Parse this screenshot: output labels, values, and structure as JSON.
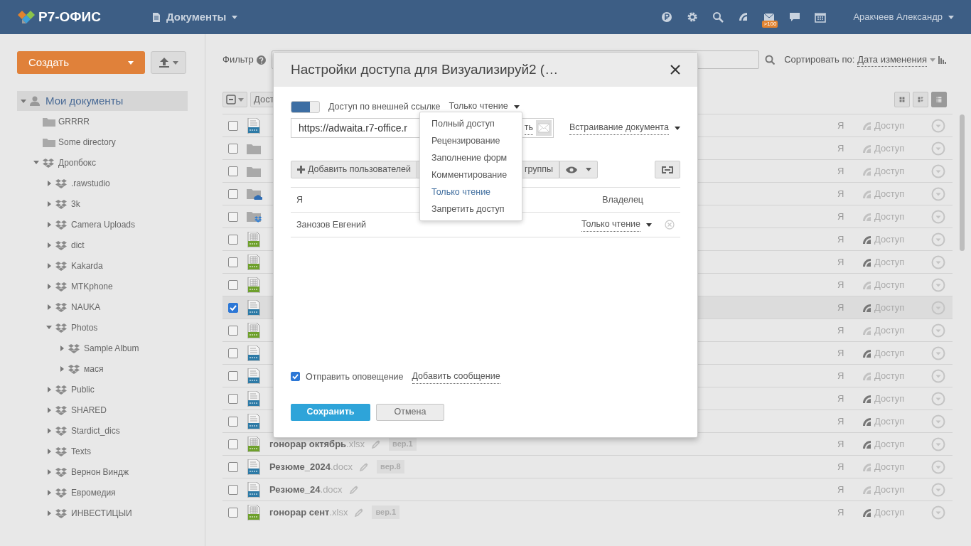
{
  "header": {
    "logo": "Р7-ОФИС",
    "module": "Документы",
    "mail_badge": ">100",
    "user": "Аракчеев Александр"
  },
  "sidebar": {
    "create": "Создать",
    "tree": [
      {
        "label": "Мои документы",
        "kind": "user",
        "expanded": true,
        "selected": true,
        "children": [
          {
            "label": "GRRRR",
            "kind": "folder",
            "selected": false
          },
          {
            "label": "Some directory",
            "kind": "folder",
            "selected": false
          },
          {
            "label": "Дропбокс",
            "kind": "dropbox",
            "expanded": true,
            "selected": false,
            "children": [
              {
                "label": ".rawstudio",
                "kind": "dropbox",
                "expanded": false,
                "selected": false
              },
              {
                "label": "3k",
                "kind": "dropbox",
                "expanded": false,
                "selected": false
              },
              {
                "label": "Camera Uploads",
                "kind": "dropbox",
                "expanded": false,
                "selected": false
              },
              {
                "label": "dict",
                "kind": "dropbox",
                "expanded": false,
                "selected": false
              },
              {
                "label": "Kakarda",
                "kind": "dropbox",
                "expanded": false,
                "selected": false
              },
              {
                "label": "MTKphone",
                "kind": "dropbox",
                "expanded": false,
                "selected": false
              },
              {
                "label": "NAUKA",
                "kind": "dropbox",
                "expanded": false,
                "selected": false
              },
              {
                "label": "Photos",
                "kind": "dropbox",
                "expanded": true,
                "selected": false,
                "children": [
                  {
                    "label": "Sample Album",
                    "kind": "dropbox",
                    "expanded": false,
                    "selected": false
                  },
                  {
                    "label": "мася",
                    "kind": "dropbox",
                    "expanded": false,
                    "selected": false
                  }
                ]
              },
              {
                "label": "Public",
                "kind": "dropbox",
                "expanded": false,
                "selected": false
              },
              {
                "label": "SHARED",
                "kind": "dropbox",
                "expanded": false,
                "selected": false
              },
              {
                "label": "Stardict_dics",
                "kind": "dropbox",
                "expanded": false,
                "selected": false
              },
              {
                "label": "Texts",
                "kind": "dropbox",
                "expanded": false,
                "selected": false
              },
              {
                "label": "Вернон Виндж",
                "kind": "dropbox",
                "expanded": false,
                "selected": false
              },
              {
                "label": "Евромедия",
                "kind": "dropbox",
                "expanded": false,
                "selected": false
              },
              {
                "label": "ИНВЕСТИЦЫИ",
                "kind": "dropbox",
                "expanded": false,
                "selected": false
              }
            ]
          }
        ]
      }
    ]
  },
  "toolbar": {
    "filter_label": "Фильтр",
    "sort_label": "Сортировать по:",
    "sort_value": "Дата изменения",
    "action_button": "Дост",
    "views": [
      {
        "kind": "tiles",
        "selected": false
      },
      {
        "kind": "compact",
        "selected": false
      },
      {
        "kind": "list",
        "selected": true
      }
    ]
  },
  "files": [
    {
      "kind": "document",
      "checked": false,
      "owner": "Я",
      "shared": false,
      "access": "Доступ"
    },
    {
      "kind": "folder",
      "checked": false,
      "owner": "Я",
      "shared": false,
      "access": "Доступ"
    },
    {
      "kind": "folder",
      "checked": false,
      "owner": "Я",
      "shared": false,
      "access": "Доступ"
    },
    {
      "kind": "cloud",
      "checked": false,
      "owner": "Я",
      "shared": false,
      "access": "Доступ"
    },
    {
      "kind": "dropbox",
      "checked": false,
      "owner": "Я",
      "shared": false,
      "access": "Доступ"
    },
    {
      "kind": "spreadsheet",
      "checked": false,
      "owner": "Я",
      "shared": true,
      "access": "Доступ"
    },
    {
      "kind": "spreadsheet",
      "checked": false,
      "owner": "Я",
      "shared": true,
      "access": "Доступ"
    },
    {
      "kind": "spreadsheet",
      "checked": false,
      "owner": "Я",
      "shared": false,
      "access": "Доступ"
    },
    {
      "kind": "document",
      "checked": true,
      "owner": "Я",
      "shared": true,
      "access": "Доступ"
    },
    {
      "kind": "spreadsheet",
      "checked": false,
      "owner": "Я",
      "shared": false,
      "access": "Доступ"
    },
    {
      "kind": "document",
      "checked": false,
      "owner": "Я",
      "shared": true,
      "access": "Доступ"
    },
    {
      "kind": "document",
      "checked": false,
      "owner": "Я",
      "shared": false,
      "access": "Доступ"
    },
    {
      "kind": "document",
      "checked": false,
      "owner": "Я",
      "shared": true,
      "access": "Доступ"
    },
    {
      "kind": "document",
      "checked": false,
      "owner": "Я",
      "shared": true,
      "access": "Доступ"
    },
    {
      "kind": "spreadsheet",
      "checked": false,
      "name": "гонорар октябрь",
      "ext": ".xlsx",
      "version": "вер.1",
      "owner": "Я",
      "shared": true,
      "access": "Доступ"
    },
    {
      "kind": "document",
      "checked": false,
      "name": "Резюме_2024",
      "ext": ".docx",
      "version": "вер.8",
      "owner": "Я",
      "shared": false,
      "access": "Доступ"
    },
    {
      "kind": "document",
      "checked": false,
      "name": "Резюме_24",
      "ext": ".docx",
      "owner": "Я",
      "shared": false,
      "access": "Доступ"
    },
    {
      "kind": "spreadsheet",
      "checked": false,
      "name": "гонорар сент",
      "ext": ".xlsx",
      "version": "вер.1",
      "owner": "Я",
      "shared": true,
      "access": "Доступ"
    }
  ],
  "dialog": {
    "title": "Настройки доступа для Визуализируй2 (…",
    "external_link": {
      "on": true,
      "label": "Доступ по внешней ссылке",
      "access": "Только чтение",
      "url": "https://adwaita.r7-office.r",
      "send_fragment": "ть",
      "embed": "Встраивание документа"
    },
    "add_users": "Добавить пользователей",
    "add_groups_fragment": "группы",
    "access_menu": [
      {
        "label": "Полный доступ",
        "selected": false
      },
      {
        "label": "Рецензирование",
        "selected": false
      },
      {
        "label": "Заполнение форм",
        "selected": false
      },
      {
        "label": "Комментирование",
        "selected": false
      },
      {
        "label": "Только чтение",
        "selected": true
      },
      {
        "label": "Запретить доступ",
        "selected": false
      }
    ],
    "shares": [
      {
        "kind": "owner",
        "name": "Я",
        "role": "Владелец"
      },
      {
        "kind": "user",
        "name": "Занозов Евгений",
        "role": "Только чтение"
      }
    ],
    "notify": {
      "checked": true,
      "label": "Отправить оповещение",
      "link": "Добавить сообщение"
    },
    "buttons": [
      {
        "kind": "primary",
        "label": "Сохранить"
      },
      {
        "kind": "secondary",
        "label": "Отмена"
      }
    ]
  }
}
